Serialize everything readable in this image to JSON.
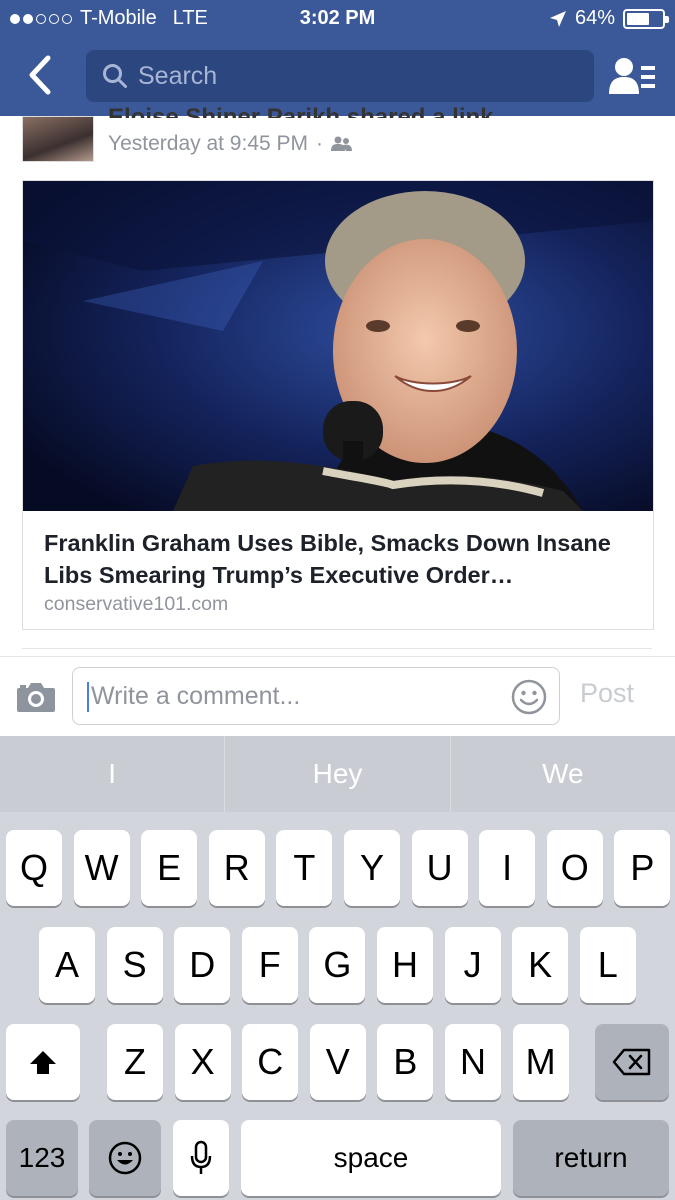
{
  "status_bar": {
    "signal_dots_filled": 2,
    "signal_dots_total": 5,
    "carrier": "T-Mobile",
    "network": "LTE",
    "time": "3:02 PM",
    "battery": "64%",
    "battery_level": 0.64,
    "icons": [
      "location-arrow-icon",
      "battery-icon"
    ]
  },
  "nav": {
    "back_icon": "chevron-left-icon",
    "search_placeholder": "Search",
    "friends_icon": "friend-list-icon"
  },
  "post": {
    "author_line": "Eloise Shiner Parikh shared a link.",
    "timestamp": "Yesterday at 9:45 PM",
    "separator": "·",
    "audience_icon": "friends-audience-icon",
    "link": {
      "title": "Franklin Graham Uses Bible, Smacks Down Insane Libs Smearing Trump’s Executive Order…",
      "domain": "conservative101.com"
    }
  },
  "comment_bar": {
    "camera_icon": "camera-icon",
    "placeholder": "Write a comment...",
    "emoji_icon": "smiley-icon",
    "post_label": "Post"
  },
  "keyboard": {
    "predictions": [
      "I",
      "Hey",
      "We"
    ],
    "row1": [
      "Q",
      "W",
      "E",
      "R",
      "T",
      "Y",
      "U",
      "I",
      "O",
      "P"
    ],
    "row2": [
      "A",
      "S",
      "D",
      "F",
      "G",
      "H",
      "J",
      "K",
      "L"
    ],
    "row3": [
      "Z",
      "X",
      "C",
      "V",
      "B",
      "N",
      "M"
    ],
    "shift_icon": "shift-icon",
    "delete_icon": "backspace-icon",
    "numbers_label": "123",
    "emoji_icon": "emoji-keyboard-icon",
    "mic_icon": "microphone-icon",
    "space_label": "space",
    "return_label": "return"
  },
  "colors": {
    "brand": "#3b5998",
    "search_bg": "#2c4680",
    "keyboard_bg": "#d2d5db",
    "caret": "#4a7cf0"
  }
}
